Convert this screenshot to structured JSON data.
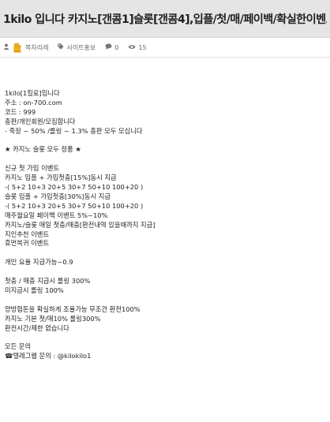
{
  "post": {
    "title": "1kilo 입니다 카지노[갠콤1]슬롯[갠콤4],입플/첫/매/페이백/확실한이벤트"
  },
  "meta": {
    "author": "복차리레",
    "category": "사이트홍보",
    "comments": "0",
    "views": "15",
    "icons": {
      "author": "user-icon",
      "category": "tag-icon",
      "comments": "comment-icon",
      "views": "eye-icon"
    }
  },
  "body": {
    "lines": [
      "1kilo[1킬로]입니다",
      "주소 : on-700.com",
      "코드 : 999",
      "총판/개인회원/모집합니다",
      "- 죽장 ~ 50% /롤링 ~ 1.3% 총판 모두 모십니다",
      "",
      "★ 카지노 슬롯 모두 정품 ★",
      "",
      "신규 첫 가입 이벤트",
      "카지노 입플 + 가입첫충[15%]동시 지급",
      "-( 5+2 10+3 20+5 30+7 50+10 100+20 )",
      "슬롯 입플 + 가입첫충[30%]동시 지급",
      "-( 5+2 10+3 20+5 30+7 50+10 100+20 )",
      "매주월요일 페이백 이벤트 5%~10%",
      "카지노/슬롯 매일 첫충/매충[환전내역 있을때까지 지급]",
      "지인추천 이벤트",
      "휴먼복귀 이벤트",
      "",
      "개인 요율 지급가능~0.9",
      "",
      "첫충 / 매충 지급시 롤링 300%",
      "미지급시 롤링 100%",
      "",
      "양방험돈을 확실하게 조율가능 무조건 환전100%",
      "카지노 기본 첫/매10% 롤링300%",
      "환전시간/제한 없습니다",
      "",
      "모든 문의",
      "☎텔레그램 문의 : @kilokilo1"
    ]
  }
}
